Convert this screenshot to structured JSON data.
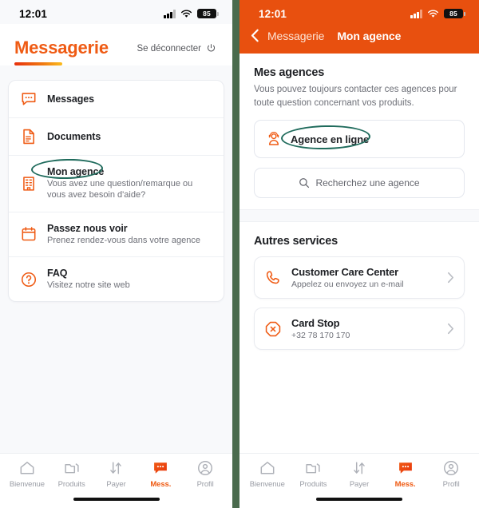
{
  "status_bar": {
    "time": "12:01",
    "battery_level": "85",
    "icons": [
      "signal-bars-icon",
      "wifi-icon",
      "battery-icon"
    ]
  },
  "colors": {
    "brand_orange": "#ef5b14",
    "header_orange": "#e8500f",
    "annotation_green": "#1f6b5c",
    "divider_green": "#4a6b4d",
    "text_dark": "#1e2024",
    "text_muted": "#6e7078"
  },
  "left_panel": {
    "title": "Messagerie",
    "logout_label": "Se déconnecter",
    "menu": [
      {
        "title": "Messages",
        "subtitle": "",
        "icon": "chat-bubble-icon"
      },
      {
        "title": "Documents",
        "subtitle": "",
        "icon": "document-icon"
      },
      {
        "title": "Mon agence",
        "subtitle": "Vous avez une question/remarque ou vous avez besoin d'aide?",
        "icon": "building-icon",
        "highlighted": true
      },
      {
        "title": "Passez nous voir",
        "subtitle": "Prenez rendez-vous dans votre agence",
        "icon": "calendar-icon"
      },
      {
        "title": "FAQ",
        "subtitle": "Visitez notre site web",
        "icon": "question-circle-icon"
      }
    ]
  },
  "right_panel": {
    "back_label": "Messagerie",
    "title": "Mon agence",
    "agencies_section": {
      "title": "Mes agences",
      "description": "Vous pouvez toujours contacter ces agences pour toute question concernant vos produits.",
      "agency_label": "Agence en ligne",
      "agency_icon": "agent-headset-icon",
      "search_placeholder": "Recherchez une agence",
      "search_icon": "search-icon"
    },
    "services_section": {
      "title": "Autres services",
      "items": [
        {
          "title": "Customer Care Center",
          "subtitle": "Appelez ou envoyez un e-mail",
          "icon": "phone-icon"
        },
        {
          "title": "Card Stop",
          "subtitle": "+32 78 170 170",
          "icon": "card-stop-icon"
        }
      ]
    }
  },
  "tab_bar": {
    "items": [
      {
        "label": "Bienvenue",
        "icon": "home-icon",
        "active": false
      },
      {
        "label": "Produits",
        "icon": "folders-icon",
        "active": false
      },
      {
        "label": "Payer",
        "icon": "transfer-arrows-icon",
        "active": false
      },
      {
        "label": "Mess.",
        "icon": "messages-icon",
        "active": true
      },
      {
        "label": "Profil",
        "icon": "person-circle-icon",
        "active": false
      }
    ]
  }
}
